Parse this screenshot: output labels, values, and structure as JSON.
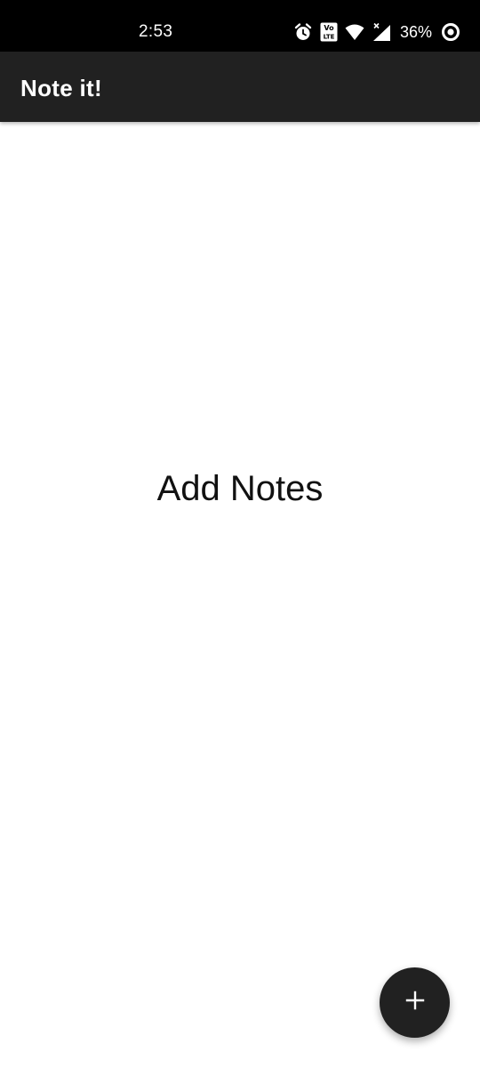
{
  "status_bar": {
    "time": "2:53",
    "battery_percent": "36%",
    "icons": [
      "alarm-icon",
      "volte-icon",
      "wifi-icon",
      "cellular-signal-icon",
      "battery-saver-icon"
    ],
    "volte_label_top": "Vo",
    "volte_label_bottom": "LTE"
  },
  "app_bar": {
    "title": "Note it!",
    "background": "#212121"
  },
  "main": {
    "empty_message": "Add Notes"
  },
  "fab": {
    "icon": "add-icon",
    "background": "#212121"
  }
}
